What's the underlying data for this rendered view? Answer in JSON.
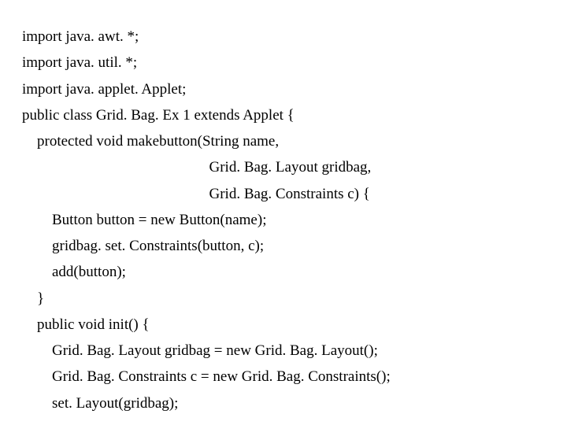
{
  "code": {
    "lines": [
      "import java. awt. *;",
      "import java. util. *;",
      "import java. applet. Applet;",
      "public class Grid. Bag. Ex 1 extends Applet {",
      "    protected void makebutton(String name,",
      "                                                  Grid. Bag. Layout gridbag,",
      "                                                  Grid. Bag. Constraints c) {",
      "        Button button = new Button(name);",
      "        gridbag. set. Constraints(button, c);",
      "        add(button);",
      "    }",
      "    public void init() {",
      "        Grid. Bag. Layout gridbag = new Grid. Bag. Layout();",
      "        Grid. Bag. Constraints c = new Grid. Bag. Constraints();",
      "        set. Layout(gridbag);"
    ]
  }
}
